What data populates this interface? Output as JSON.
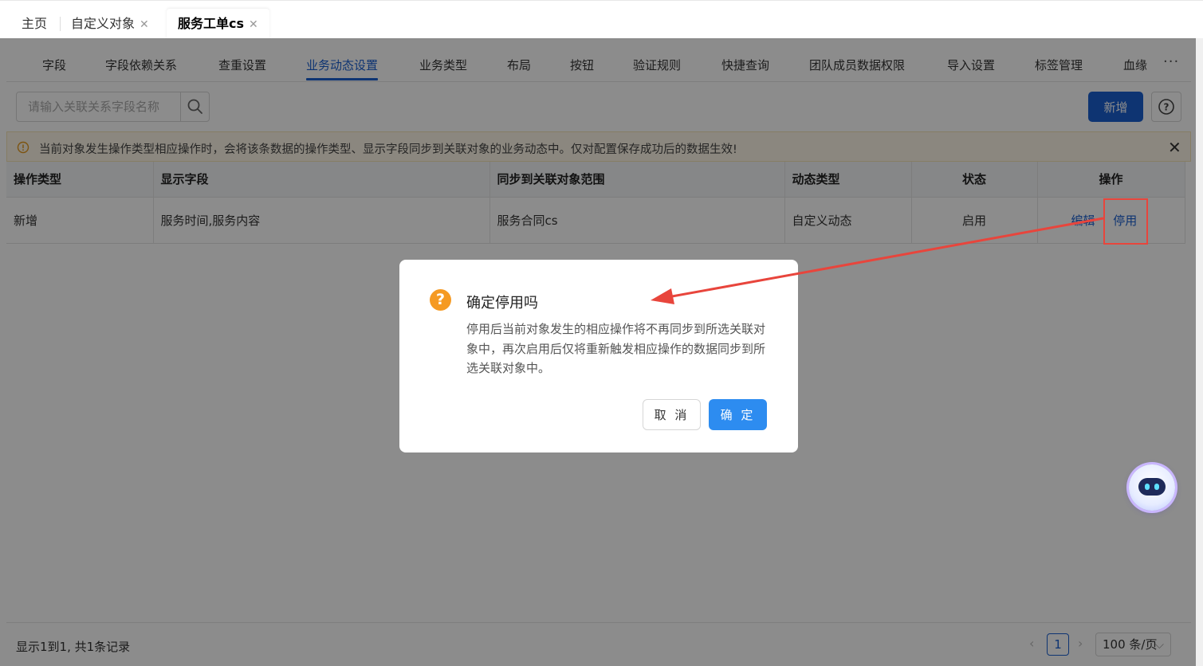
{
  "top_tabs": [
    {
      "label": "主页"
    },
    {
      "label": "自定义对象"
    },
    {
      "label": "服务工单cs"
    }
  ],
  "sub_tabs": [
    "字段",
    "字段依赖关系",
    "查重设置",
    "业务动态设置",
    "业务类型",
    "布局",
    "按钮",
    "验证规则",
    "快捷查询",
    "团队成员数据权限",
    "导入设置",
    "标签管理",
    "血缘"
  ],
  "active_sub_tab": "业务动态设置",
  "search": {
    "placeholder": "请输入关联关系字段名称"
  },
  "toolbar": {
    "add_label": "新增"
  },
  "notice": {
    "text": "当前对象发生操作类型相应操作时，会将该条数据的操作类型、显示字段同步到关联对象的业务动态中。仅对配置保存成功后的数据生效!"
  },
  "table": {
    "columns": [
      "操作类型",
      "显示字段",
      "同步到关联对象范围",
      "动态类型",
      "状态",
      "操作"
    ],
    "rows": [
      {
        "op_type": "新增",
        "fields": "服务时间,服务内容",
        "scope": "服务合同cs",
        "dyn_type": "自定义动态",
        "status": "启用",
        "actions": [
          "编辑",
          "停用"
        ]
      }
    ]
  },
  "footer": {
    "info": "显示1到1, 共1条记录",
    "page": "1",
    "page_size": "100 条/页"
  },
  "dialog": {
    "title": "确定停用吗",
    "body": "停用后当前对象发生的相应操作将不再同步到所选关联对象中，再次启用后仅将重新触发相应操作的数据同步到所选关联对象中。",
    "cancel": "取 消",
    "ok": "确 定"
  },
  "colors": {
    "primary": "#1a5fd0",
    "confirm": "#2d8cf0",
    "warning_icon": "#f59a23",
    "annotation": "#e8453c"
  }
}
